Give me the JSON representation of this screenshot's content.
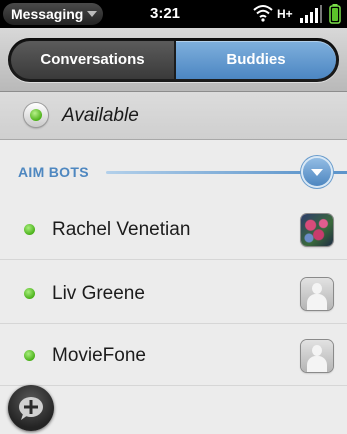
{
  "status_bar": {
    "app_menu_label": "Messaging",
    "time": "3:21",
    "network": "H+",
    "icons": [
      "wifi-icon",
      "signal-bars-icon",
      "battery-icon"
    ]
  },
  "tabs": [
    {
      "label": "Conversations",
      "selected": false
    },
    {
      "label": "Buddies",
      "selected": true
    }
  ],
  "availability": {
    "label": "Available",
    "color": "#4eb21a"
  },
  "group": {
    "label": "AIM BOTS",
    "expanded": true,
    "accent": "#4e87c0"
  },
  "buddies": [
    {
      "name": "Rachel Venetian",
      "status": "online",
      "avatar": "photo"
    },
    {
      "name": "Liv Greene",
      "status": "online",
      "avatar": "generic-person-icon"
    },
    {
      "name": "MovieFone",
      "status": "online",
      "avatar": "generic-person-icon"
    }
  ],
  "fab": {
    "icon": "new-message-icon"
  }
}
